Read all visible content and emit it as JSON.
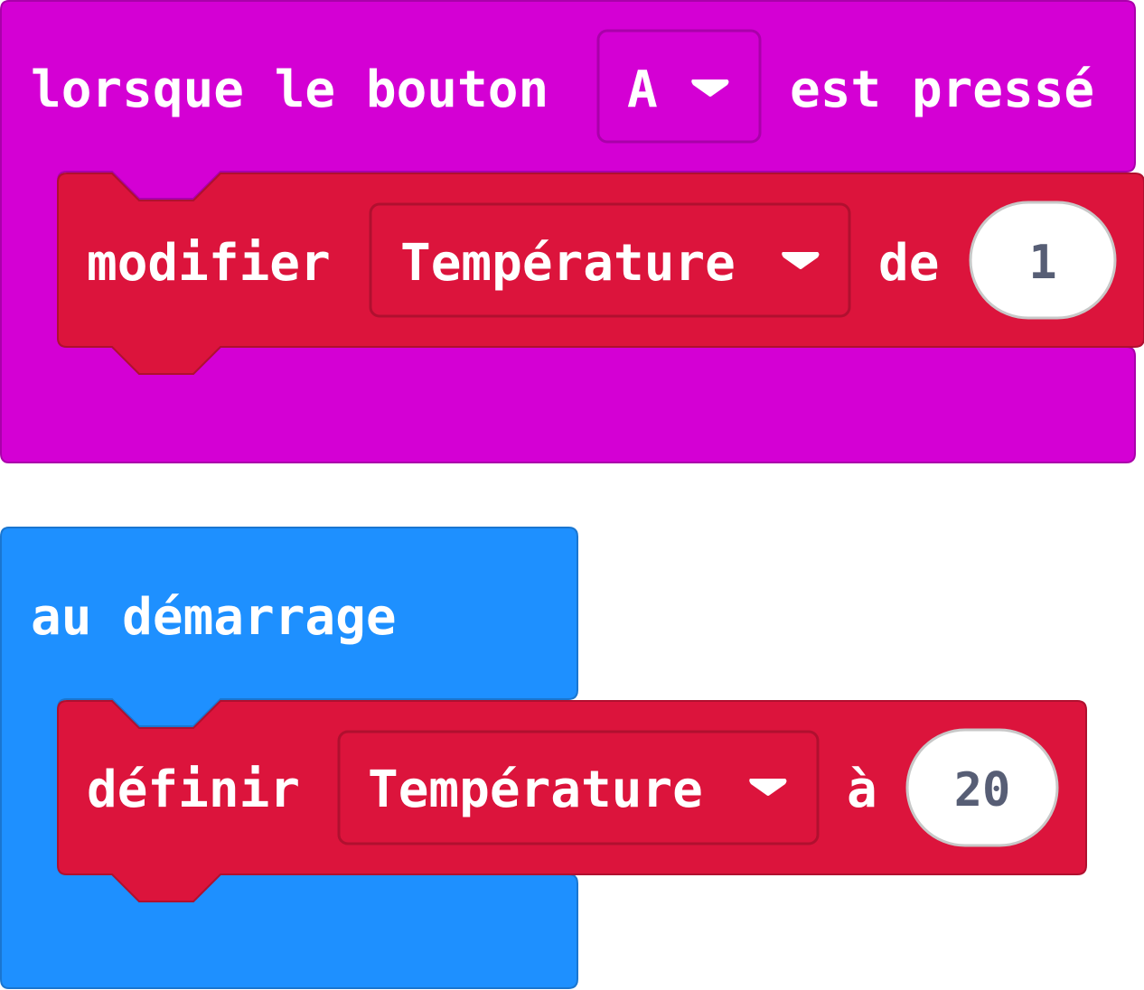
{
  "event_block": {
    "prefix": "lorsque le bouton",
    "button_value": "A",
    "suffix": "est pressé",
    "color": "#d400d4",
    "border": "#aa00aa"
  },
  "change_block": {
    "label": "modifier",
    "variable": "Température",
    "connector": "de",
    "value": "1",
    "color": "#dc143c",
    "border": "#b0102f"
  },
  "start_block": {
    "label": "au démarrage",
    "color": "#1e90ff",
    "border": "#1a76d0"
  },
  "set_block": {
    "label": "définir",
    "variable": "Température",
    "connector": "à",
    "value": "20",
    "color": "#dc143c",
    "border": "#b0102f"
  },
  "icons": {
    "dropdown": "caret-down-icon"
  }
}
